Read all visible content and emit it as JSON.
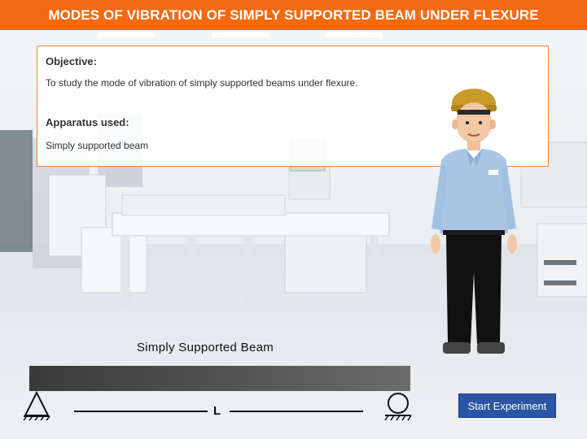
{
  "header": {
    "title": "MODES OF VIBRATION OF SIMPLY SUPPORTED BEAM UNDER FLEXURE"
  },
  "info": {
    "objective_heading": "Objective:",
    "objective_text": "To study the mode of vibration of simply supported beams under flexure.",
    "apparatus_heading": "Apparatus used:",
    "apparatus_text": "Simply supported beam"
  },
  "beam": {
    "title": "Simply Supported Beam",
    "length_label": "L"
  },
  "actions": {
    "start_label": "Start Experiment"
  },
  "colors": {
    "header_bg": "#f26a12",
    "panel_border": "#f0843c",
    "button_bg": "#2a55a5",
    "beam": "#4a4a4a"
  }
}
